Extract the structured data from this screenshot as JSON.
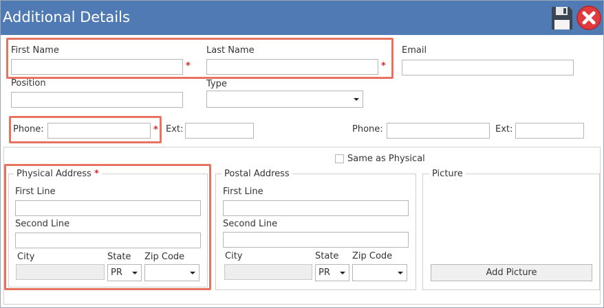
{
  "window": {
    "title": "Additional Details"
  },
  "toolbar": {
    "save_icon": "floppy-disk-icon",
    "close_icon": "close-circle-icon"
  },
  "contact": {
    "first_name_label": "First Name",
    "last_name_label": "Last Name",
    "email_label": "Email",
    "position_label": "Position",
    "type_label": "Type",
    "first_name_value": "",
    "last_name_value": "",
    "email_value": "",
    "position_value": "",
    "type_value": ""
  },
  "phone": {
    "phone_label": "Phone:",
    "ext_label": "Ext:",
    "phone2_label": "Phone:",
    "ext2_label": "Ext:"
  },
  "required_marker": "*",
  "same_as_physical": {
    "label": "Same as Physical",
    "checked": false
  },
  "physical_address": {
    "legend": "Physical Address",
    "first_line_label": "First Line",
    "second_line_label": "Second Line",
    "city_label": "City",
    "state_label": "State",
    "zip_label": "Zip Code",
    "state_value": "PR",
    "zip_value": ""
  },
  "postal_address": {
    "legend": "Postal Address",
    "first_line_label": "First Line",
    "second_line_label": "Second Line",
    "city_label": "City",
    "state_label": "State",
    "zip_label": "Zip Code",
    "state_value": "PR",
    "zip_value": ""
  },
  "picture": {
    "legend": "Picture",
    "add_button_label": "Add Picture"
  },
  "colors": {
    "titlebar": "#4f7ab3",
    "highlight": "#e6735f",
    "required": "#e0252b"
  }
}
